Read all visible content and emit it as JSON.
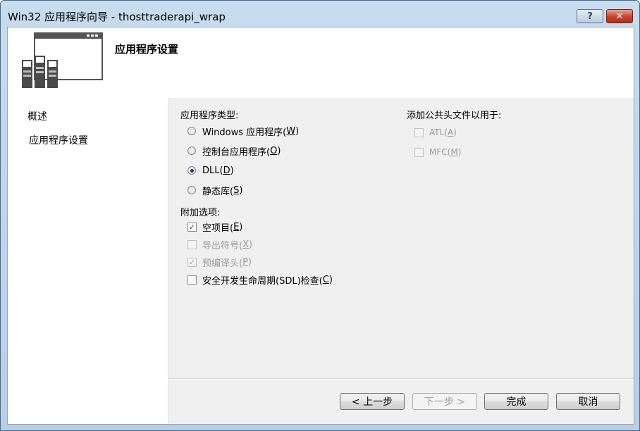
{
  "window": {
    "title": "Win32 应用程序向导 - thosttraderapi_wrap",
    "help_label": "?",
    "close_label": "✕"
  },
  "header": {
    "title": "应用程序设置"
  },
  "sidebar": {
    "items": [
      {
        "label": "概述"
      },
      {
        "label": "应用程序设置"
      }
    ]
  },
  "app_type": {
    "label": "应用程序类型:",
    "options": [
      {
        "text": "Windows 应用程序(",
        "key": "W",
        "end": ")",
        "checked": false
      },
      {
        "text": "控制台应用程序(",
        "key": "O",
        "end": ")",
        "checked": false
      },
      {
        "text": "DLL(",
        "key": "D",
        "end": ")",
        "checked": true
      },
      {
        "text": "静态库(",
        "key": "S",
        "end": ")",
        "checked": false
      }
    ]
  },
  "extra": {
    "label": "附加选项:",
    "options": [
      {
        "text": "空项目(",
        "key": "E",
        "end": ")",
        "checked": true,
        "disabled": false
      },
      {
        "text": "导出符号(",
        "key": "X",
        "end": ")",
        "checked": false,
        "disabled": true
      },
      {
        "text": "预编译头(",
        "key": "P",
        "end": ")",
        "checked": true,
        "disabled": true
      },
      {
        "text": "安全开发生命周期(SDL)检查(",
        "key": "C",
        "end": ")",
        "checked": false,
        "disabled": false
      }
    ]
  },
  "headers": {
    "label": "添加公共头文件以用于:",
    "options": [
      {
        "text": "ATL(",
        "key": "A",
        "end": ")",
        "checked": false,
        "disabled": true
      },
      {
        "text": "MFC(",
        "key": "M",
        "end": ")",
        "checked": false,
        "disabled": true
      }
    ]
  },
  "buttons": {
    "prev": "< 上一步",
    "next": "下一步 >",
    "finish": "完成",
    "cancel": "取消"
  }
}
